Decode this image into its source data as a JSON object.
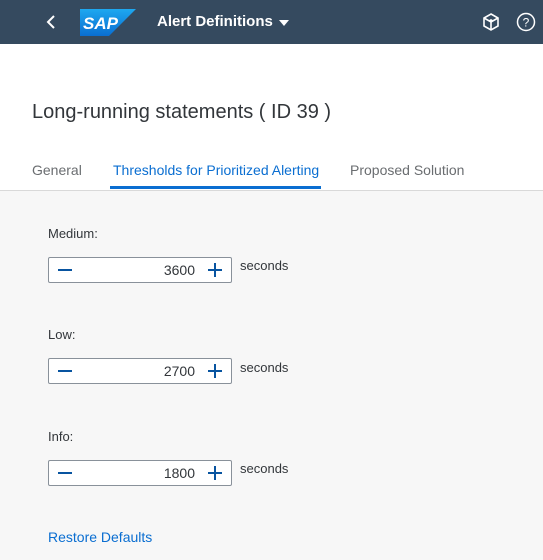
{
  "shell": {
    "logo_text": "SAP",
    "app_title": "Alert Definitions"
  },
  "page": {
    "title": "Long-running statements ( ID 39 )"
  },
  "tabs": [
    {
      "label": "General",
      "active": false
    },
    {
      "label": "Thresholds for Prioritized Alerting",
      "active": true
    },
    {
      "label": "Proposed Solution",
      "active": false
    }
  ],
  "thresholds": [
    {
      "label": "Medium:",
      "value": "3600",
      "unit": "seconds"
    },
    {
      "label": "Low:",
      "value": "2700",
      "unit": "seconds"
    },
    {
      "label": "Info:",
      "value": "1800",
      "unit": "seconds"
    }
  ],
  "actions": {
    "restore_label": "Restore Defaults"
  },
  "colors": {
    "shell_bg": "#354a5f",
    "accent": "#0a6ed1",
    "logo_blue": "#0a86d8"
  }
}
